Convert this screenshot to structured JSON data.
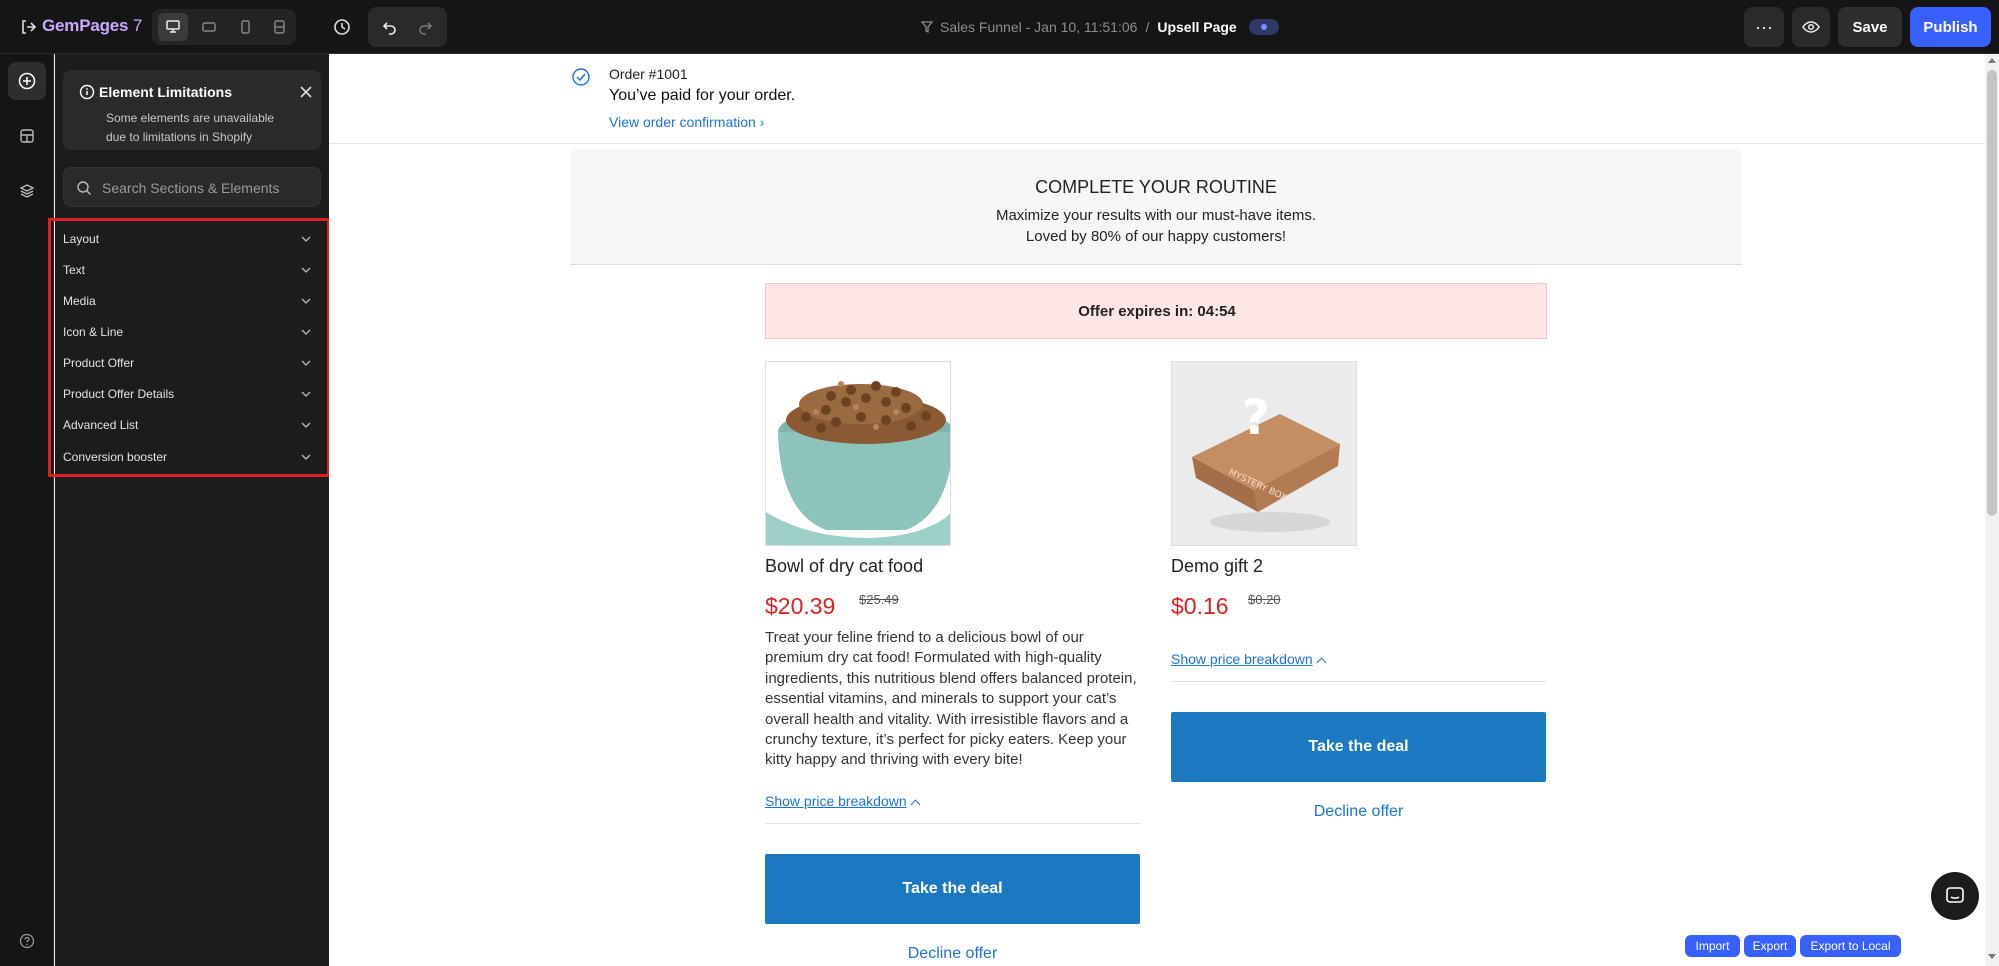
{
  "topbar": {
    "logo": "GemPages",
    "logo_version": "7",
    "funnel_name": "Sales Funnel - Jan 10, 11:51:06",
    "separator": "/",
    "page_name": "Upsell Page",
    "more_label": "···",
    "save_label": "Save",
    "publish_label": "Publish"
  },
  "sidebar": {
    "notice": {
      "title": "Element Limitations",
      "body": "Some elements are unavailable due to limitations in Shopify"
    },
    "search_placeholder": "Search Sections & Elements",
    "categories": [
      "Layout",
      "Text",
      "Media",
      "Icon & Line",
      "Product Offer",
      "Product Offer Details",
      "Advanced List",
      "Conversion booster"
    ]
  },
  "page": {
    "order_number": "Order #1001",
    "paid_message": "You’ve paid for your order.",
    "view_confirmation": "View order confirmation ›",
    "routine_heading": "COMPLETE YOUR ROUTINE",
    "routine_line1": "Maximize your results with our must-have items.",
    "routine_line2": "Loved by 80% of our happy customers!",
    "timer_text": "Offer expires in: 04:54",
    "products": [
      {
        "title": "Bowl of dry cat food",
        "price": "$20.39",
        "old_price": "$25.49",
        "description": "Treat your feline friend to a delicious bowl of our premium dry cat food! Formulated with high-quality ingredients, this nutritious blend offers balanced protein, essential vitamins, and minerals to support your cat’s overall health and vitality. With irresistible flavors and a crunchy texture, it’s perfect for picky eaters. Keep your kitty happy and thriving with every bite!",
        "breakdown_label": "Show price breakdown",
        "deal_label": "Take the deal",
        "decline_label": "Decline offer"
      },
      {
        "title": "Demo gift 2",
        "price": "$0.16",
        "old_price": "$0.20",
        "box_text": "MYSTERY BOX",
        "breakdown_label": "Show price breakdown",
        "deal_label": "Take the deal",
        "decline_label": "Decline offer"
      }
    ]
  },
  "footer_buttons": {
    "import": "Import",
    "export": "Export",
    "export_local": "Export to Local"
  },
  "colors": {
    "accent": "#3860ff",
    "deal_button": "#1a79c0",
    "price_red": "#d92121",
    "highlight_box": "#e11d26"
  }
}
